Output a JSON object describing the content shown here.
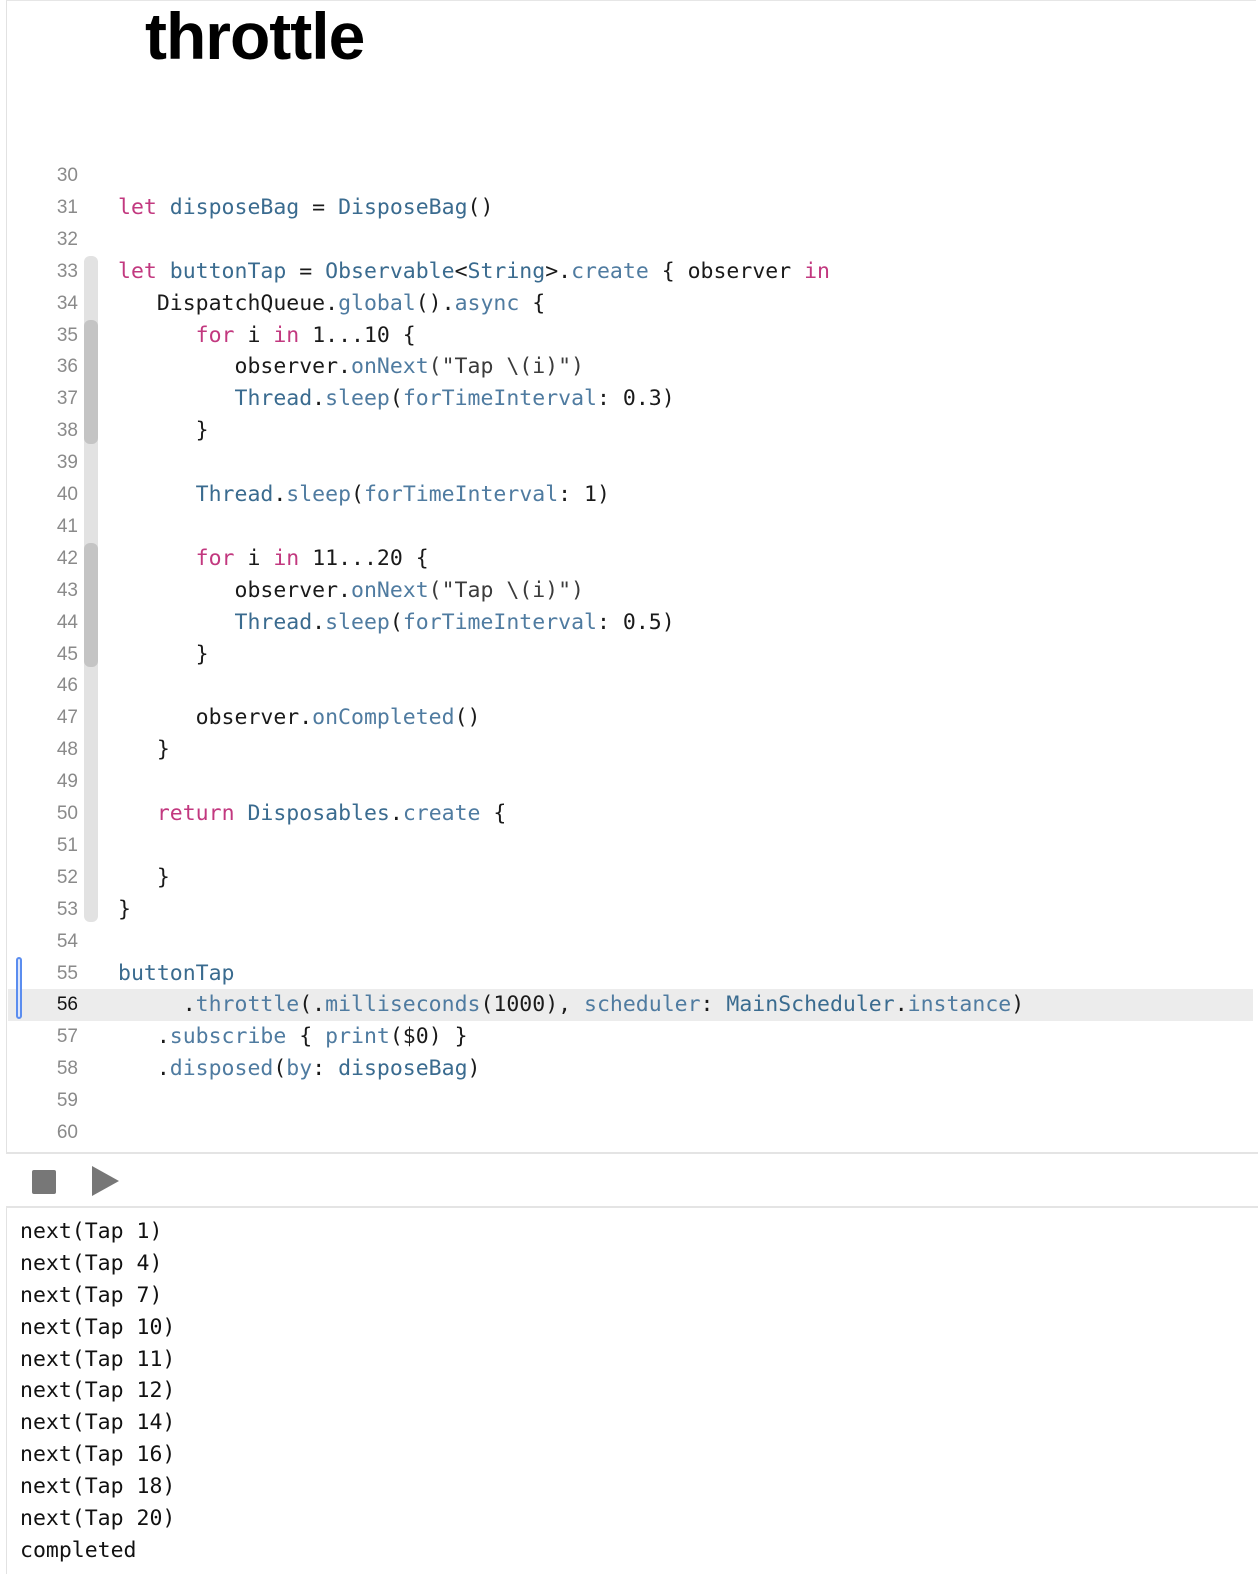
{
  "page": {
    "title": "throttle"
  },
  "editor": {
    "lines": [
      {
        "number": "30",
        "tokens": []
      },
      {
        "number": "31",
        "tokens": [
          {
            "t": "let ",
            "c": "keyword"
          },
          {
            "t": "disposeBag",
            "c": "var"
          },
          {
            "t": " = ",
            "c": "plain"
          },
          {
            "t": "DisposeBag",
            "c": "type"
          },
          {
            "t": "()",
            "c": "plain"
          }
        ]
      },
      {
        "number": "32",
        "tokens": []
      },
      {
        "number": "33",
        "tokens": [
          {
            "t": "let ",
            "c": "keyword"
          },
          {
            "t": "buttonTap",
            "c": "var"
          },
          {
            "t": " = ",
            "c": "plain"
          },
          {
            "t": "Observable",
            "c": "type"
          },
          {
            "t": "<",
            "c": "plain"
          },
          {
            "t": "String",
            "c": "type"
          },
          {
            "t": ">.",
            "c": "plain"
          },
          {
            "t": "create",
            "c": "method"
          },
          {
            "t": " { observer ",
            "c": "plain"
          },
          {
            "t": "in",
            "c": "keyword"
          }
        ]
      },
      {
        "number": "34",
        "tokens": [
          {
            "t": "   DispatchQueue.",
            "c": "plain"
          },
          {
            "t": "global",
            "c": "method"
          },
          {
            "t": "().",
            "c": "plain"
          },
          {
            "t": "async",
            "c": "method"
          },
          {
            "t": " {",
            "c": "plain"
          }
        ]
      },
      {
        "number": "35",
        "tokens": [
          {
            "t": "      ",
            "c": "plain"
          },
          {
            "t": "for",
            "c": "keyword"
          },
          {
            "t": " i ",
            "c": "plain"
          },
          {
            "t": "in",
            "c": "keyword"
          },
          {
            "t": " 1...10 {",
            "c": "plain"
          }
        ]
      },
      {
        "number": "36",
        "tokens": [
          {
            "t": "         observer.",
            "c": "plain"
          },
          {
            "t": "onNext",
            "c": "method"
          },
          {
            "t": "(\"Tap \\(i)\")",
            "c": "string"
          }
        ]
      },
      {
        "number": "37",
        "tokens": [
          {
            "t": "         ",
            "c": "plain"
          },
          {
            "t": "Thread",
            "c": "type"
          },
          {
            "t": ".",
            "c": "plain"
          },
          {
            "t": "sleep",
            "c": "method"
          },
          {
            "t": "(",
            "c": "plain"
          },
          {
            "t": "forTimeInterval",
            "c": "param"
          },
          {
            "t": ": 0.3)",
            "c": "plain"
          }
        ]
      },
      {
        "number": "38",
        "tokens": [
          {
            "t": "      }",
            "c": "plain"
          }
        ]
      },
      {
        "number": "39",
        "tokens": []
      },
      {
        "number": "40",
        "tokens": [
          {
            "t": "      ",
            "c": "plain"
          },
          {
            "t": "Thread",
            "c": "type"
          },
          {
            "t": ".",
            "c": "plain"
          },
          {
            "t": "sleep",
            "c": "method"
          },
          {
            "t": "(",
            "c": "plain"
          },
          {
            "t": "forTimeInterval",
            "c": "param"
          },
          {
            "t": ": 1)",
            "c": "plain"
          }
        ]
      },
      {
        "number": "41",
        "tokens": []
      },
      {
        "number": "42",
        "tokens": [
          {
            "t": "      ",
            "c": "plain"
          },
          {
            "t": "for",
            "c": "keyword"
          },
          {
            "t": " i ",
            "c": "plain"
          },
          {
            "t": "in",
            "c": "keyword"
          },
          {
            "t": " 11...20 {",
            "c": "plain"
          }
        ]
      },
      {
        "number": "43",
        "tokens": [
          {
            "t": "         observer.",
            "c": "plain"
          },
          {
            "t": "onNext",
            "c": "method"
          },
          {
            "t": "(\"Tap \\(i)\")",
            "c": "string"
          }
        ]
      },
      {
        "number": "44",
        "tokens": [
          {
            "t": "         ",
            "c": "plain"
          },
          {
            "t": "Thread",
            "c": "type"
          },
          {
            "t": ".",
            "c": "plain"
          },
          {
            "t": "sleep",
            "c": "method"
          },
          {
            "t": "(",
            "c": "plain"
          },
          {
            "t": "forTimeInterval",
            "c": "param"
          },
          {
            "t": ": 0.5)",
            "c": "plain"
          }
        ]
      },
      {
        "number": "45",
        "tokens": [
          {
            "t": "      }",
            "c": "plain"
          }
        ]
      },
      {
        "number": "46",
        "tokens": []
      },
      {
        "number": "47",
        "tokens": [
          {
            "t": "      observer.",
            "c": "plain"
          },
          {
            "t": "onCompleted",
            "c": "method"
          },
          {
            "t": "()",
            "c": "plain"
          }
        ]
      },
      {
        "number": "48",
        "tokens": [
          {
            "t": "   }",
            "c": "plain"
          }
        ]
      },
      {
        "number": "49",
        "tokens": []
      },
      {
        "number": "50",
        "tokens": [
          {
            "t": "   ",
            "c": "plain"
          },
          {
            "t": "return",
            "c": "keyword"
          },
          {
            "t": " ",
            "c": "plain"
          },
          {
            "t": "Disposables",
            "c": "type"
          },
          {
            "t": ".",
            "c": "plain"
          },
          {
            "t": "create",
            "c": "method"
          },
          {
            "t": " {",
            "c": "plain"
          }
        ]
      },
      {
        "number": "51",
        "tokens": []
      },
      {
        "number": "52",
        "tokens": [
          {
            "t": "   }",
            "c": "plain"
          }
        ]
      },
      {
        "number": "53",
        "tokens": [
          {
            "t": "}",
            "c": "plain"
          }
        ]
      },
      {
        "number": "54",
        "tokens": []
      },
      {
        "number": "55",
        "tokens": [
          {
            "t": "buttonTap",
            "c": "var"
          }
        ]
      },
      {
        "number": "56",
        "current": true,
        "tokens": [
          {
            "t": "     .",
            "c": "plain"
          },
          {
            "t": "throttle",
            "c": "method"
          },
          {
            "t": "(.",
            "c": "plain"
          },
          {
            "t": "milliseconds",
            "c": "method"
          },
          {
            "t": "(1000), ",
            "c": "plain"
          },
          {
            "t": "scheduler",
            "c": "param"
          },
          {
            "t": ": ",
            "c": "plain"
          },
          {
            "t": "MainScheduler",
            "c": "type"
          },
          {
            "t": ".",
            "c": "plain"
          },
          {
            "t": "instance",
            "c": "method"
          },
          {
            "t": ")",
            "c": "plain"
          }
        ]
      },
      {
        "number": "57",
        "tokens": [
          {
            "t": "   .",
            "c": "plain"
          },
          {
            "t": "subscribe",
            "c": "method"
          },
          {
            "t": " { ",
            "c": "plain"
          },
          {
            "t": "print",
            "c": "method"
          },
          {
            "t": "($0) }",
            "c": "plain"
          }
        ]
      },
      {
        "number": "58",
        "tokens": [
          {
            "t": "   .",
            "c": "plain"
          },
          {
            "t": "disposed",
            "c": "method"
          },
          {
            "t": "(",
            "c": "plain"
          },
          {
            "t": "by",
            "c": "param"
          },
          {
            "t": ": ",
            "c": "plain"
          },
          {
            "t": "disposeBag",
            "c": "var"
          },
          {
            "t": ")",
            "c": "plain"
          }
        ]
      },
      {
        "number": "59",
        "tokens": []
      },
      {
        "number": "60",
        "tokens": []
      }
    ]
  },
  "toolbar": {
    "stop_icon": "stop-icon",
    "run_icon": "play-icon"
  },
  "console": {
    "lines": [
      "next(Tap 1)",
      "next(Tap 4)",
      "next(Tap 7)",
      "next(Tap 10)",
      "next(Tap 11)",
      "next(Tap 12)",
      "next(Tap 14)",
      "next(Tap 16)",
      "next(Tap 18)",
      "next(Tap 20)",
      "completed"
    ]
  }
}
